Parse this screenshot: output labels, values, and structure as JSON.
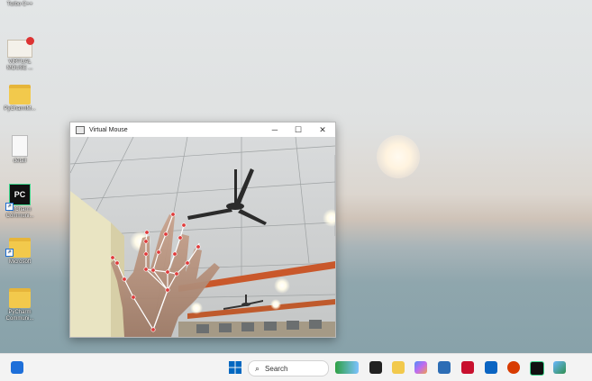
{
  "desktop": {
    "icons": [
      {
        "label": "Turbo C++"
      },
      {
        "label": "VIRTUAL MOUSE ..."
      },
      {
        "label": "PyCharmM..."
      },
      {
        "label": "detail"
      },
      {
        "label": "PyCharm Communi..."
      },
      {
        "label": "Microsoft"
      },
      {
        "label": "PyCharm Communi..."
      }
    ]
  },
  "window": {
    "title": "Virtual Mouse",
    "minimize": "─",
    "maximize": "☐",
    "close": "✕"
  },
  "taskbar": {
    "search_label": "Search",
    "apps": [
      "widgets",
      "start",
      "search",
      "copilot",
      "task-view",
      "file-explorer",
      "microsoft-store",
      "mcafee",
      "outlook",
      "office",
      "pycharm",
      "photos"
    ]
  },
  "colors": {
    "accent": "#0067c0",
    "landmark": "#e03a3a"
  }
}
